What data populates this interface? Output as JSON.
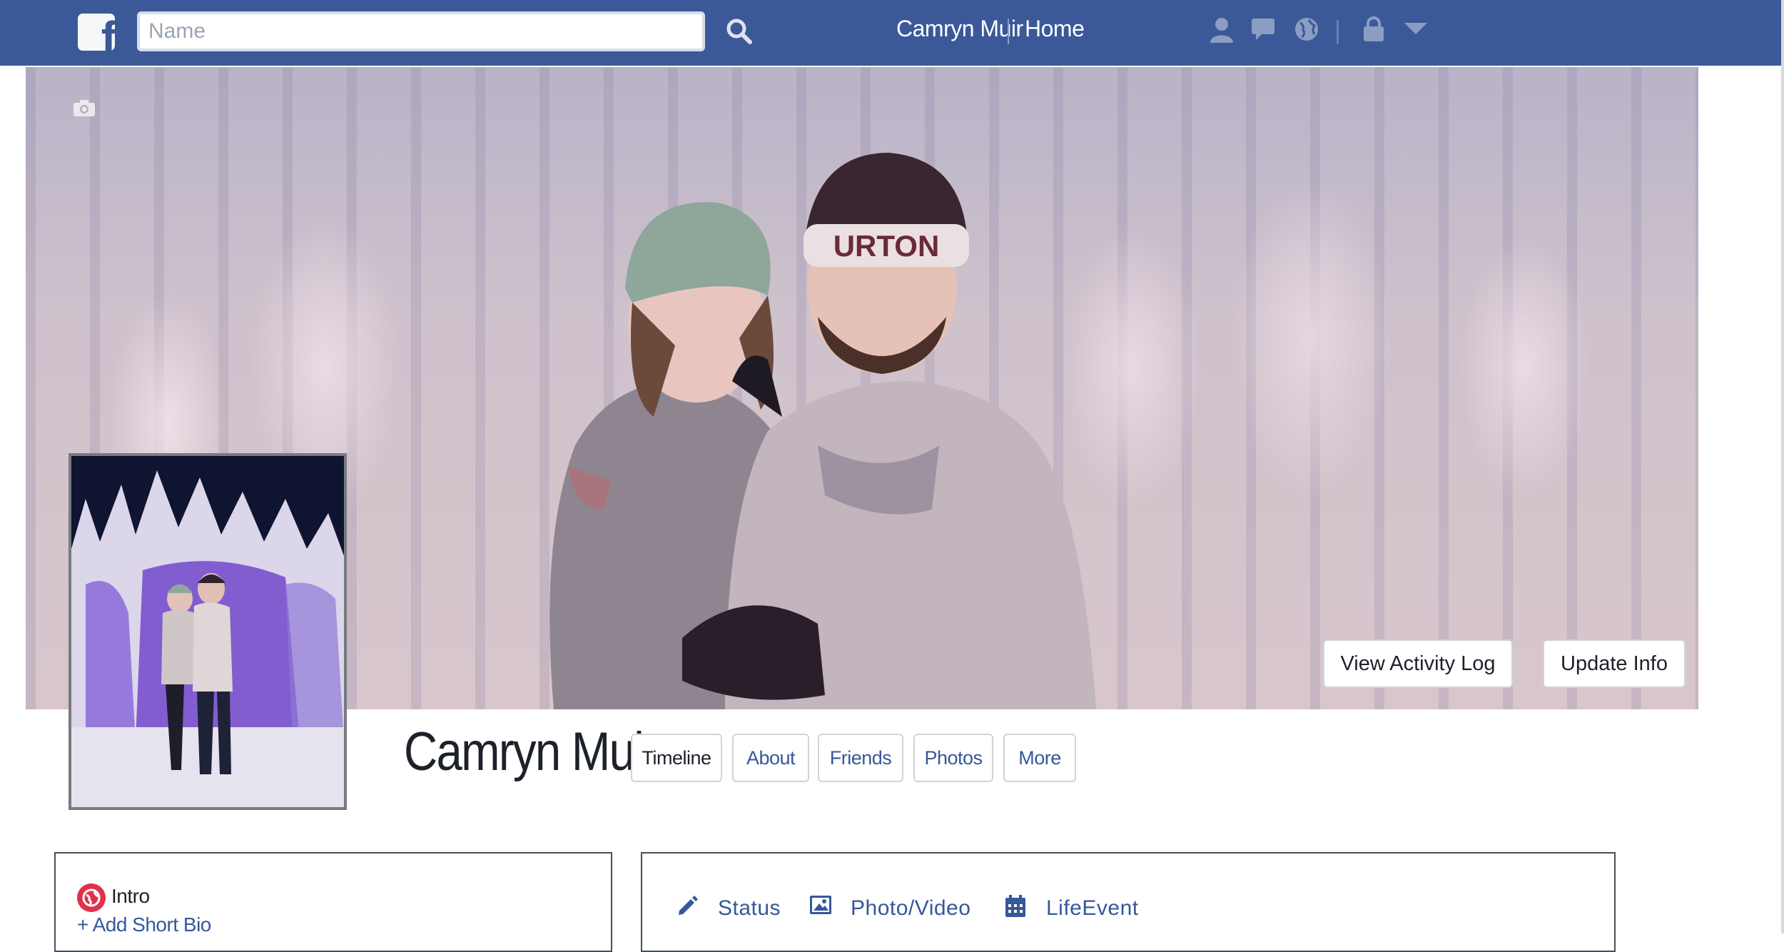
{
  "header": {
    "search_placeholder": "Name",
    "user_name": "Camryn Muir",
    "home_label": "Home",
    "icons": [
      "friends-icon",
      "messages-icon",
      "notifications-globe-icon",
      "privacy-lock-icon",
      "account-menu-chevron-icon"
    ]
  },
  "cover": {
    "view_activity_log_label": "View Activity Log",
    "update_info_label": "Update Info"
  },
  "profile": {
    "name": "Camryn Muir",
    "tabs": [
      {
        "label": "Timeline",
        "active": true
      },
      {
        "label": "About",
        "active": false
      },
      {
        "label": "Friends",
        "active": false
      },
      {
        "label": "Photos",
        "active": false
      },
      {
        "label": "More",
        "active": false
      }
    ]
  },
  "intro": {
    "title": "Intro",
    "add_bio_label": "+ Add Short Bio"
  },
  "composer": {
    "items": [
      {
        "label": "Status",
        "icon": "pencil-icon"
      },
      {
        "label": "Photo/Video",
        "icon": "image-icon"
      },
      {
        "label": "LifeEvent",
        "icon": "calendar-icon"
      }
    ]
  },
  "colors": {
    "brand": "#3b5998",
    "link": "#365899",
    "intro_icon": "#e0324b"
  }
}
